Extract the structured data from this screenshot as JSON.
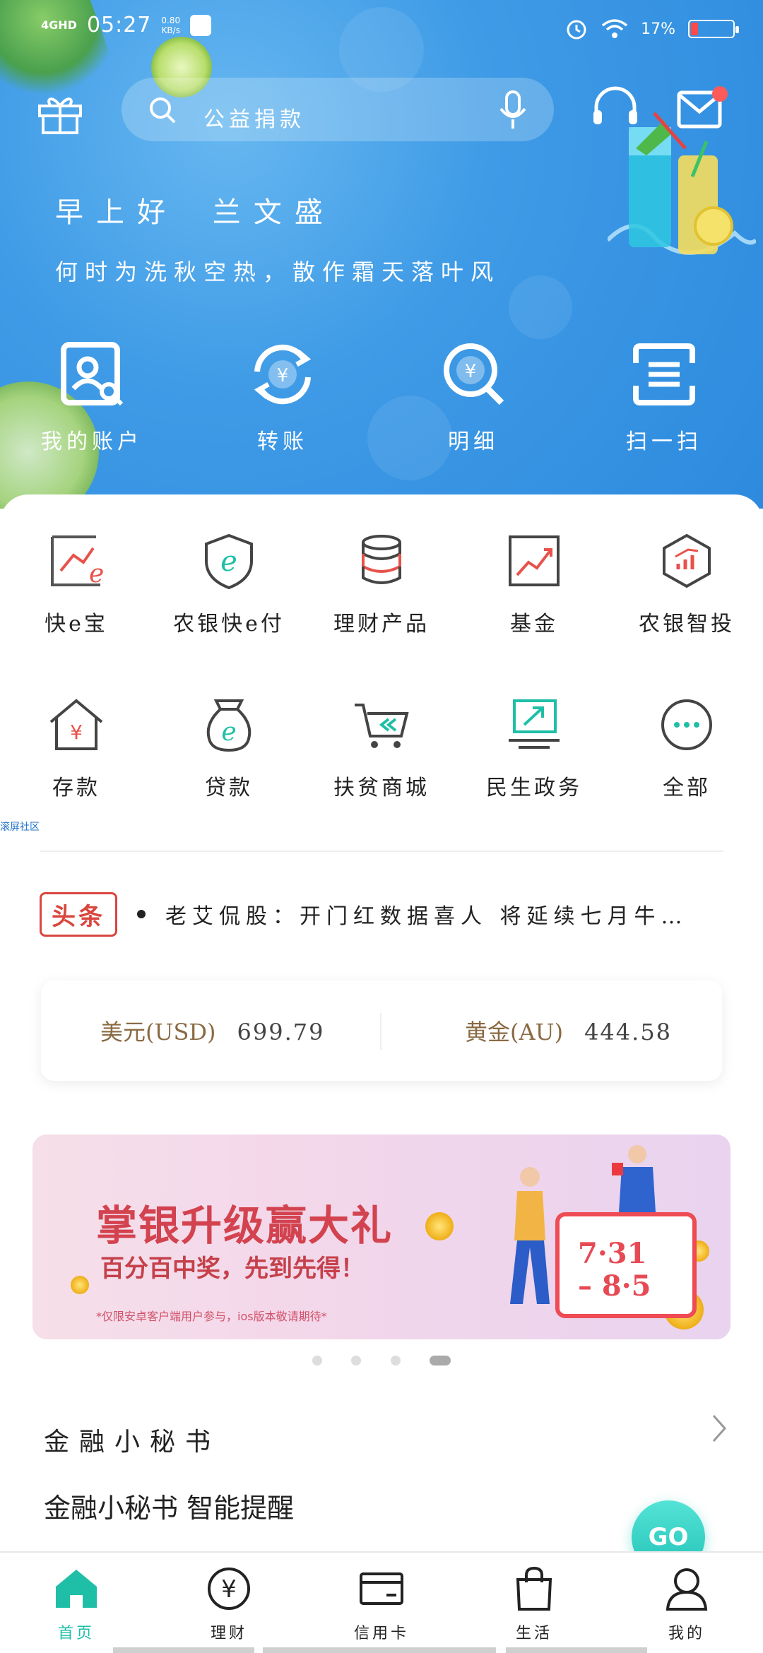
{
  "status_bar": {
    "network": "4GHD",
    "time": "05:27",
    "speed": "0.80",
    "speed_unit": "KB/s",
    "battery": "17%",
    "battery_level": 0.17
  },
  "header": {
    "search_placeholder": "公益捐款"
  },
  "greeting": {
    "hello": "早上好",
    "name": "兰文盛",
    "poem": "何时为洗秋空热，散作霜天落叶风"
  },
  "quick_actions": [
    {
      "label": "我的账户",
      "icon": "account-icon"
    },
    {
      "label": "转账",
      "icon": "transfer-icon"
    },
    {
      "label": "明细",
      "icon": "details-icon"
    },
    {
      "label": "扫一扫",
      "icon": "scan-icon"
    }
  ],
  "services_row1": [
    {
      "label": "快e宝",
      "icon": "kuaie-bao-icon"
    },
    {
      "label": "农银快e付",
      "icon": "e-pay-shield-icon"
    },
    {
      "label": "理财产品",
      "icon": "coin-stack-icon"
    },
    {
      "label": "基金",
      "icon": "fund-chart-icon"
    },
    {
      "label": "农银智投",
      "icon": "smart-invest-icon"
    }
  ],
  "services_row2": [
    {
      "label": "存款",
      "icon": "deposit-house-icon"
    },
    {
      "label": "贷款",
      "icon": "loan-bag-icon"
    },
    {
      "label": "扶贫商城",
      "icon": "cart-icon"
    },
    {
      "label": "民生政务",
      "icon": "gov-computer-icon"
    },
    {
      "label": "全部",
      "icon": "more-icon"
    }
  ],
  "watermark": "滚屏社区",
  "news": {
    "tag": "头条",
    "headline": "老艾侃股：开门红数据喜人 将延续七月牛…"
  },
  "rates": {
    "usd_label": "美元(USD)",
    "usd_value": "699.79",
    "gold_label": "黄金(AU)",
    "gold_value": "444.58"
  },
  "banner": {
    "title": "掌银升级赢大礼",
    "subtitle": "百分百中奖，先到先得！",
    "note": "*仅限安卓客户端用户参与，ios版本敬请期待*",
    "date": "7·31\n– 8·5",
    "page_count": 4,
    "active_page": 4
  },
  "section": {
    "title": "金融小秘书",
    "subtitle": "金融小秘书 智能提醒",
    "go_label": "GO"
  },
  "tabbar": [
    {
      "label": "首页",
      "icon": "home-icon",
      "active": true
    },
    {
      "label": "理财",
      "icon": "yuan-icon",
      "active": false
    },
    {
      "label": "信用卡",
      "icon": "credit-card-icon",
      "active": false
    },
    {
      "label": "生活",
      "icon": "shopping-bag-icon",
      "active": false
    },
    {
      "label": "我的",
      "icon": "user-icon",
      "active": false
    }
  ],
  "colors": {
    "hero_blue": "#3f9be6",
    "accent_teal": "#1fbfa7",
    "news_red": "#d9463e",
    "rate_gold": "#8a6a43"
  }
}
